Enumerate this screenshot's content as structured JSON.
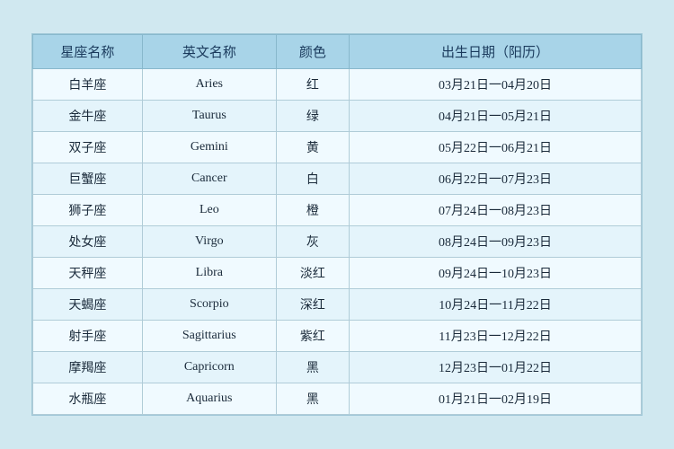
{
  "table": {
    "headers": [
      "星座名称",
      "英文名称",
      "颜色",
      "出生日期（阳历）"
    ],
    "rows": [
      {
        "cn": "白羊座",
        "en": "Aries",
        "color": "红",
        "date": "03月21日一04月20日"
      },
      {
        "cn": "金牛座",
        "en": "Taurus",
        "color": "绿",
        "date": "04月21日一05月21日"
      },
      {
        "cn": "双子座",
        "en": "Gemini",
        "color": "黄",
        "date": "05月22日一06月21日"
      },
      {
        "cn": "巨蟹座",
        "en": "Cancer",
        "color": "白",
        "date": "06月22日一07月23日"
      },
      {
        "cn": "狮子座",
        "en": "Leo",
        "color": "橙",
        "date": "07月24日一08月23日"
      },
      {
        "cn": "处女座",
        "en": "Virgo",
        "color": "灰",
        "date": "08月24日一09月23日"
      },
      {
        "cn": "天秤座",
        "en": "Libra",
        "color": "淡红",
        "date": "09月24日一10月23日"
      },
      {
        "cn": "天蝎座",
        "en": "Scorpio",
        "color": "深红",
        "date": "10月24日一11月22日"
      },
      {
        "cn": "射手座",
        "en": "Sagittarius",
        "color": "紫红",
        "date": "11月23日一12月22日"
      },
      {
        "cn": "摩羯座",
        "en": "Capricorn",
        "color": "黑",
        "date": "12月23日一01月22日"
      },
      {
        "cn": "水瓶座",
        "en": "Aquarius",
        "color": "黑",
        "date": "01月21日一02月19日"
      }
    ]
  }
}
